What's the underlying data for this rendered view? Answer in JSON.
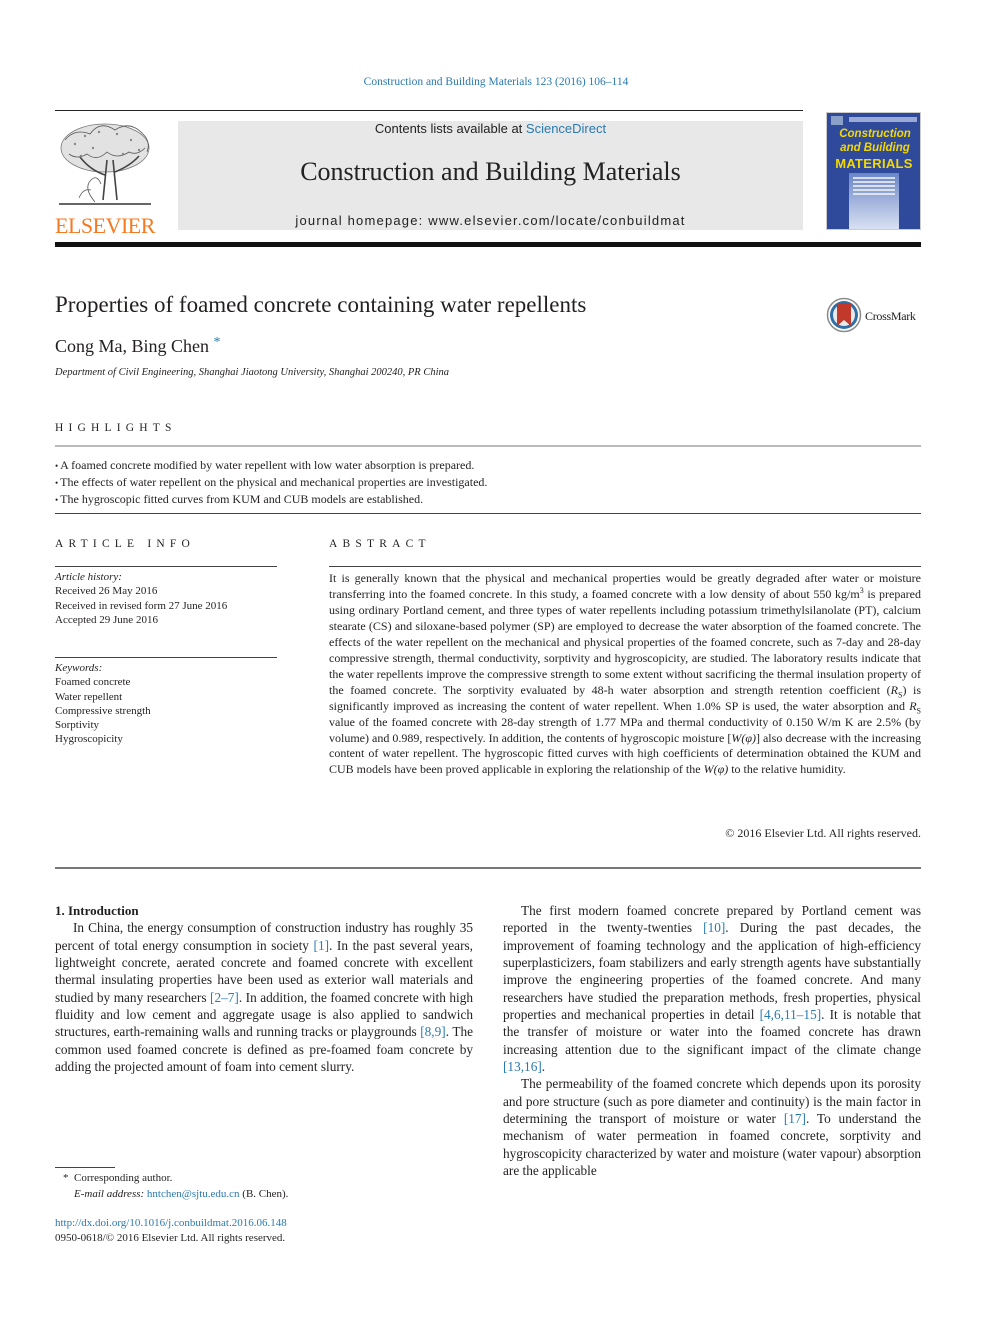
{
  "header": {
    "journal_ref": "Construction and Building Materials 123 (2016) 106–114",
    "contents_prefix": "Contents lists available at ",
    "contents_link": "ScienceDirect",
    "journal_title": "Construction and Building Materials",
    "homepage": "journal homepage: www.elsevier.com/locate/conbuildmat",
    "publisher_logo": "ELSEVIER",
    "cover": {
      "title_line1": "Construction",
      "title_line2": "and Building",
      "title_line3": "MATERIALS"
    },
    "colors": {
      "link": "#2a7ab0",
      "elsevier_orange": "#f47920",
      "cover_blue": "#2f4a9b",
      "cover_yellow": "#f5d800",
      "banner_gray": "#e8e8e8"
    }
  },
  "article": {
    "title": "Properties of foamed concrete containing water repellents",
    "crossmark_label": "CrossMark",
    "authors": "Cong Ma, Bing Chen",
    "author_mark": "*",
    "affiliation": "Department of Civil Engineering, Shanghai Jiaotong University, Shanghai 200240, PR China"
  },
  "highlights": {
    "heading": "HIGHLIGHTS",
    "items": [
      "A foamed concrete modified by water repellent with low water absorption is prepared.",
      "The effects of water repellent on the physical and mechanical properties are investigated.",
      "The hygroscopic fitted curves from KUM and CUB models are established."
    ]
  },
  "article_info": {
    "heading": "ARTICLE INFO",
    "history_label": "Article history:",
    "history": [
      "Received 26 May 2016",
      "Received in revised form 27 June 2016",
      "Accepted 29 June 2016"
    ],
    "keywords_label": "Keywords:",
    "keywords": [
      "Foamed concrete",
      "Water repellent",
      "Compressive strength",
      "Sorptivity",
      "Hygroscopicity"
    ]
  },
  "abstract": {
    "heading": "ABSTRACT",
    "parts": {
      "p1": "It is generally known that the physical and mechanical properties would be greatly degraded after water or moisture transferring into the foamed concrete. In this study, a foamed concrete with a low density of about 550 kg/m",
      "sup3": "3",
      "p2": " is prepared using ordinary Portland cement, and three types of water repellents includ­ing potassium trimethylsilanolate (PT), calcium stearate (CS) and siloxane-based polymer (SP) are employed to decrease the water absorption of the foamed concrete. The effects of the water repellent on the mechanical and physical properties of the foamed concrete, such as 7-day and 28-day compressive strength, thermal conductivity, sorptivity and hygroscopicity, are studied. The laboratory results indicate that the water repellents improve the compressive strength to some extent without sacrificing the ther­mal insulation property of the foamed concrete. The sorptivity evaluated by 48-h water absorption and strength retention coefficient (",
      "rs1": "R",
      "rs1_sub": "S",
      "p3": ") is significantly improved as increasing the content of water repellent. When 1.0% SP is used, the water absorption and ",
      "rs2": "R",
      "rs2_sub": "S",
      "p4": " value of the foamed concrete with 28-day strength of 1.77 MPa and thermal conductivity of 0.150 W/m K are 2.5% (by volume) and 0.989, respectively. In addi­tion, the contents of hygroscopic moisture [",
      "w1": "W(φ)",
      "p5": "] also decrease with the increasing content of water repellent. The hygroscopic fitted curves with high coefficients of determination obtained the KUM and CUB models have been proved applicable in exploring the relationship of the ",
      "w2": "W(φ)",
      "p6": " to the relative humidity."
    },
    "copyright": "© 2016 Elsevier Ltd. All rights reserved."
  },
  "body": {
    "section_heading": "1. Introduction",
    "left_para": {
      "t1": "In China, the energy consumption of construction industry has roughly 35 percent of total energy consumption in society ",
      "r1": "[1]",
      "t2": ". In the past several years, lightweight concrete, aerated concrete and foamed concrete with excellent thermal insulating properties have been used as exterior wall materials and studied by many researchers ",
      "r2": "[2–7]",
      "t3": ". In addition, the foamed concrete with high fluid­ity and low cement and aggregate usage is also applied to sand­wich structures, earth-remaining walls and running tracks or playgrounds ",
      "r3": "[8,9]",
      "t4": ". The common used foamed concrete is defined as pre-foamed foam concrete by adding the projected amount of foam into cement slurry."
    },
    "right_para1": {
      "t1": "The first modern foamed concrete prepared by Portland cement was reported in the twenty-twenties ",
      "r1": "[10]",
      "t2": ". During the past decades, the improvement of foaming technology and the application of high-efficiency superplasticizers, foam stabilizers and early strength agents have substantially improve the engineering prop­erties of the foamed concrete. And many researchers have studied the preparation methods, fresh properties, physical properties and mechanical properties in detail ",
      "r2": "[4,6,11–15]",
      "t3": ". It is notable that the transfer of moisture or water into the foamed concrete has drawn increasing attention due to the significant impact of the climate change ",
      "r3": "[13,16]",
      "t4": "."
    },
    "right_para2": {
      "t1": "The permeability of the foamed concrete which depends upon its porosity and pore structure (such as pore diameter and continu­ity) is the main factor in determining the transport of moisture or water ",
      "r1": "[17]",
      "t2": ". To understand the mechanism of water permeation in foamed concrete, sorptivity and hygroscopicity characterized by water and moisture (water vapour) absorption are the applicable"
    }
  },
  "footnotes": {
    "mark": "*",
    "corresponding": "Corresponding author.",
    "email_label": "E-mail address: ",
    "email": "hntchen@sjtu.edu.cn",
    "email_suffix": " (B. Chen).",
    "doi": "http://dx.doi.org/10.1016/j.conbuildmat.2016.06.148",
    "issn": "0950-0618/© 2016 Elsevier Ltd. All rights reserved."
  }
}
